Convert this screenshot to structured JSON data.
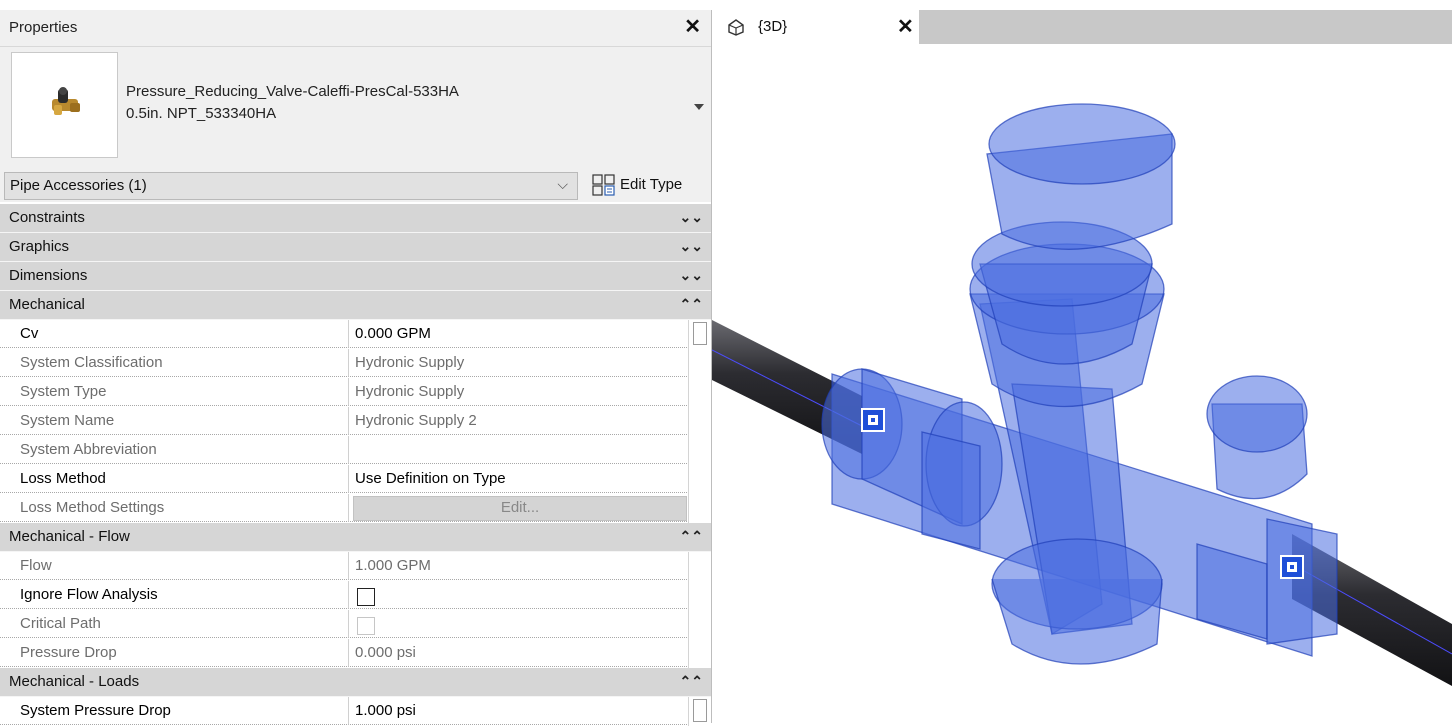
{
  "properties": {
    "title": "Properties",
    "type_selector": {
      "name_line1": "Pressure_Reducing_Valve-Caleffi-PresCal-533HA",
      "name_line2": "0.5in. NPT_533340HA"
    },
    "filter": "Pipe Accessories (1)",
    "edit_type_label": "Edit Type",
    "sections": {
      "constraints": "Constraints",
      "graphics": "Graphics",
      "dimensions": "Dimensions",
      "mechanical": "Mechanical",
      "mechanical_flow": "Mechanical - Flow",
      "mechanical_loads": "Mechanical - Loads"
    },
    "mechanical": [
      {
        "name": "Cv",
        "value": "0.000 GPM"
      },
      {
        "name": "System Classification",
        "value": "Hydronic Supply"
      },
      {
        "name": "System Type",
        "value": "Hydronic Supply"
      },
      {
        "name": "System Name",
        "value": "Hydronic Supply 2"
      },
      {
        "name": "System Abbreviation",
        "value": ""
      },
      {
        "name": "Loss Method",
        "value": "Use Definition on Type"
      },
      {
        "name": "Loss Method Settings",
        "value": "Edit..."
      }
    ],
    "flow": [
      {
        "name": "Flow",
        "value": "1.000 GPM"
      },
      {
        "name": "Ignore Flow Analysis",
        "checked": false
      },
      {
        "name": "Critical Path",
        "checked": false
      },
      {
        "name": "Pressure Drop",
        "value": "0.000 psi"
      }
    ],
    "loads": [
      {
        "name": "System Pressure Drop",
        "value": "1.000 psi"
      }
    ]
  },
  "view": {
    "tab_label": "{3D}"
  },
  "icons": {
    "close": "close-icon",
    "view3d": "3d-view-icon",
    "edit_type": "edit-type-icon",
    "collapse": "collapse-icon",
    "expand": "expand-icon",
    "connector": "connector-grip-icon"
  },
  "colors": {
    "valve_body": "#4a6ee0",
    "pipe": "#2a2a2e",
    "section_bg": "#d6d6d6",
    "connector": "#1f4fd8"
  }
}
